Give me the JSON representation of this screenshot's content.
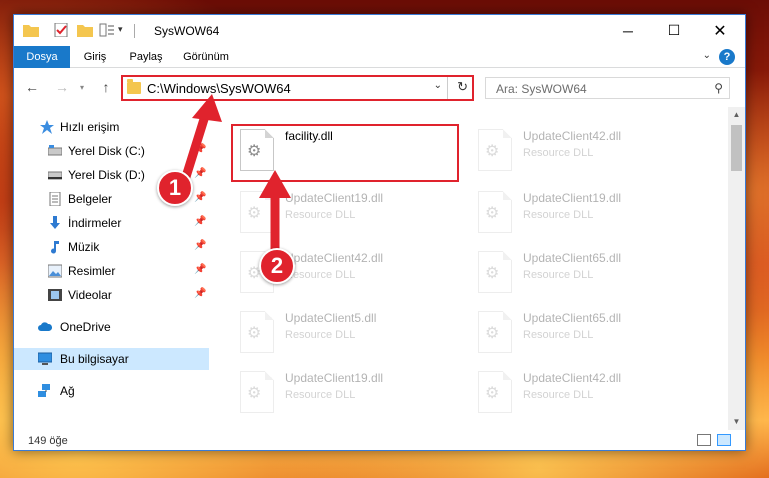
{
  "window": {
    "title": "SysWOW64"
  },
  "ribbon": {
    "tabs": [
      "Dosya",
      "Giriş",
      "Paylaş",
      "Görünüm"
    ],
    "help": "?"
  },
  "address": {
    "path": "C:\\Windows\\SysWOW64"
  },
  "search": {
    "placeholder": "Ara: SysWOW64"
  },
  "nav": {
    "items": [
      {
        "label": "Hızlı erişim",
        "icon": "star-icon"
      },
      {
        "label": "Yerel Disk (C:)",
        "icon": "drive-icon",
        "pinned": true
      },
      {
        "label": "Yerel Disk (D:)",
        "icon": "drive-icon",
        "pinned": true
      },
      {
        "label": "Belgeler",
        "icon": "documents-icon",
        "pinned": true
      },
      {
        "label": "İndirmeler",
        "icon": "download-icon",
        "pinned": true
      },
      {
        "label": "Müzik",
        "icon": "music-icon",
        "pinned": true
      },
      {
        "label": "Resimler",
        "icon": "pictures-icon",
        "pinned": true
      },
      {
        "label": "Videolar",
        "icon": "video-icon",
        "pinned": true
      },
      {
        "label": "OneDrive",
        "icon": "cloud-icon"
      },
      {
        "label": "Bu bilgisayar",
        "icon": "computer-icon",
        "selected": true
      },
      {
        "label": "Ağ",
        "icon": "network-icon"
      }
    ]
  },
  "files": [
    {
      "name": "facility.dll",
      "type": "",
      "highlighted": true
    },
    {
      "name": "UpdateClient42.dll",
      "type": "Resource DLL"
    },
    {
      "name": "UpdateClient19.dll",
      "type": "Resource DLL"
    },
    {
      "name": "UpdateClient19.dll",
      "type": "Resource DLL"
    },
    {
      "name": "UpdateClient42.dll",
      "type": "Resource DLL"
    },
    {
      "name": "UpdateClient65.dll",
      "type": "Resource DLL"
    },
    {
      "name": "UpdateClient5.dll",
      "type": "Resource DLL"
    },
    {
      "name": "UpdateClient65.dll",
      "type": "Resource DLL"
    },
    {
      "name": "UpdateClient19.dll",
      "type": "Resource DLL"
    },
    {
      "name": "UpdateClient42.dll",
      "type": "Resource DLL"
    }
  ],
  "status": {
    "count": "149 öğe"
  },
  "callouts": [
    "1",
    "2"
  ],
  "colors": {
    "accent": "#1979ca",
    "callout": "#e0232d",
    "selection": "#cce8ff"
  }
}
